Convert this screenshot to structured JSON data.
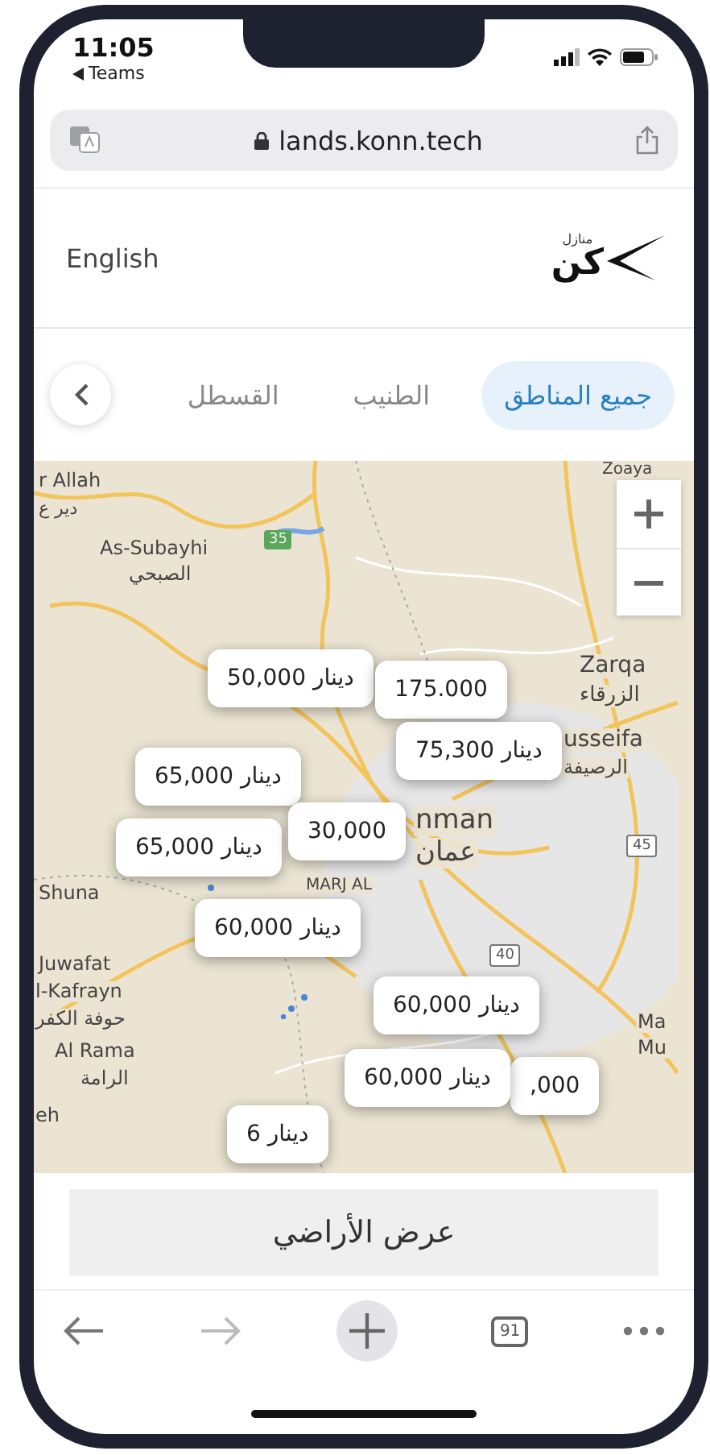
{
  "status_bar": {
    "time": "11:05",
    "back_app": "Teams"
  },
  "address_bar": {
    "url": "lands.konn.tech"
  },
  "header": {
    "language": "English",
    "logo_tagline": "منازل",
    "logo_name": "كن"
  },
  "tabs": [
    {
      "label": "جميع المناطق",
      "selected": true
    },
    {
      "label": "الطنيب",
      "selected": false
    },
    {
      "label": "القسطل",
      "selected": false
    }
  ],
  "map": {
    "labels": [
      {
        "text": "r Allah"
      },
      {
        "text": "دير ع"
      },
      {
        "text": "As-Subayhi"
      },
      {
        "text": "الصبحي"
      },
      {
        "text": "Zoaya"
      },
      {
        "text": "Zarqa"
      },
      {
        "text": "الزرقاء"
      },
      {
        "text": "usseifa"
      },
      {
        "text": "الرصيفة"
      },
      {
        "text": "nman"
      },
      {
        "text": "عمان"
      },
      {
        "text": "Shuna"
      },
      {
        "text": "MARJ AL"
      },
      {
        "text": "Juwafat"
      },
      {
        "text": "l-Kafrayn"
      },
      {
        "text": "حوفة الكفر"
      },
      {
        "text": "Al Rama"
      },
      {
        "text": "الرامة"
      },
      {
        "text": "eh"
      },
      {
        "text": "Ma"
      },
      {
        "text": "Mu"
      }
    ],
    "road_shields": [
      {
        "text": "35",
        "kind": "green"
      },
      {
        "text": "45",
        "kind": "plain"
      },
      {
        "text": "40",
        "kind": "plain"
      }
    ],
    "markers": [
      {
        "price": "50,000 دينار"
      },
      {
        "price": "175.000"
      },
      {
        "price": "75,300 دينار"
      },
      {
        "price": "65,000 دينار"
      },
      {
        "price": "65,000 دينار"
      },
      {
        "price": "30,000"
      },
      {
        "price": "60,000 دينار"
      },
      {
        "price": "60,000 دينار"
      },
      {
        "price": ",000"
      },
      {
        "price": "60,000 دينار"
      },
      {
        "price": "دينار 6"
      }
    ]
  },
  "action_button": {
    "label": "عرض الأراضي"
  },
  "toolbar": {
    "tab_count": "91"
  }
}
